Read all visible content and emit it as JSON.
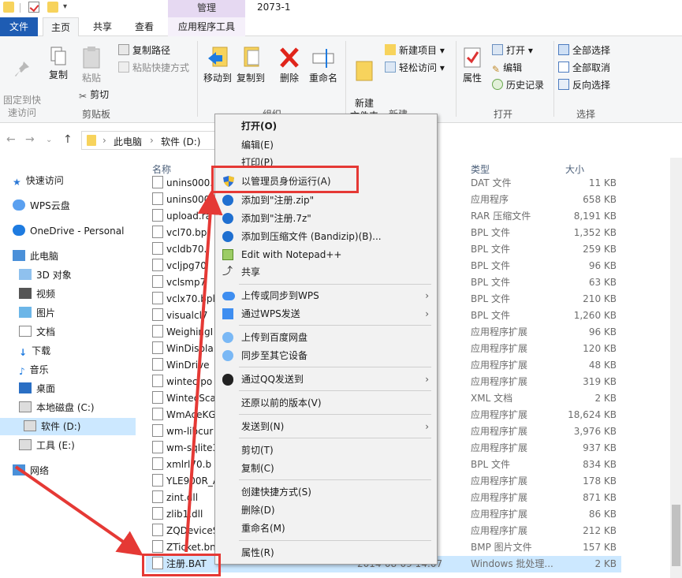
{
  "window": {
    "title": "2073-1",
    "context_tab": "管理"
  },
  "tabs": [
    "文件",
    "主页",
    "共享",
    "查看",
    "应用程序工具"
  ],
  "ribbon": {
    "clipboard": {
      "pin": "固定到快\n速访问",
      "copy": "复制",
      "paste": "粘贴",
      "copy_path": "复制路径",
      "paste_shortcut": "粘贴快捷方式",
      "cut": "剪切",
      "label": "剪贴板"
    },
    "organize": {
      "move_to": "移动到",
      "copy_to": "复制到",
      "delete": "删除",
      "rename": "重命名",
      "label": "组织"
    },
    "new": {
      "new_folder": "新建\n文件夹",
      "new_item": "新建项目",
      "easy_access": "轻松访问",
      "label": "新建"
    },
    "open": {
      "properties": "属性",
      "open": "打开",
      "edit": "编辑",
      "history": "历史记录",
      "label": "打开"
    },
    "select": {
      "select_all": "全部选择",
      "select_none": "全部取消",
      "invert": "反向选择",
      "label": "选择"
    }
  },
  "address": {
    "crumbs": [
      "此电脑",
      "软件 (D:)"
    ]
  },
  "nav": {
    "items": [
      "快速访问",
      "WPS云盘",
      "OneDrive - Personal",
      "此电脑",
      "3D 对象",
      "视频",
      "图片",
      "文档",
      "下载",
      "音乐",
      "桌面",
      "本地磁盘 (C:)",
      "软件 (D:)",
      "工具 (E:)",
      "网络"
    ]
  },
  "filelist": {
    "headers": {
      "name": "名称",
      "type": "类型",
      "size": "大小"
    },
    "rows": [
      {
        "name": "unins000.",
        "type": "DAT 文件",
        "size": "11 KB"
      },
      {
        "name": "unins000.e",
        "type": "应用程序",
        "size": "658 KB"
      },
      {
        "name": "upload.ra",
        "type": "RAR 压缩文件",
        "size": "8,191 KB"
      },
      {
        "name": "vcl70.bpl",
        "type": "BPL 文件",
        "size": "1,352 KB"
      },
      {
        "name": "vcldb70.",
        "type": "BPL 文件",
        "size": "259 KB"
      },
      {
        "name": "vcljpg70",
        "type": "BPL 文件",
        "size": "96 KB"
      },
      {
        "name": "vclsmp7",
        "type": "BPL 文件",
        "size": "63 KB"
      },
      {
        "name": "vclx70.bpl",
        "type": "BPL 文件",
        "size": "210 KB"
      },
      {
        "name": "visualcl7",
        "type": "BPL 文件",
        "size": "1,260 KB"
      },
      {
        "name": "WeighingI",
        "type": "应用程序扩展",
        "size": "96 KB"
      },
      {
        "name": "WinDispla",
        "type": "应用程序扩展",
        "size": "120 KB"
      },
      {
        "name": "WinDrive",
        "type": "应用程序扩展",
        "size": "48 KB"
      },
      {
        "name": "wintec.po",
        "type": "应用程序扩展",
        "size": "319 KB"
      },
      {
        "name": "WintecSca",
        "type": "XML 文档",
        "size": "2 KB"
      },
      {
        "name": "WmAceKG",
        "type": "应用程序扩展",
        "size": "18,624 KB"
      },
      {
        "name": "wm-libcur",
        "type": "应用程序扩展",
        "size": "3,976 KB"
      },
      {
        "name": "wm-sqlite3",
        "type": "应用程序扩展",
        "size": "937 KB"
      },
      {
        "name": "xmlrl70.b",
        "type": "BPL 文件",
        "size": "834 KB"
      },
      {
        "name": "YLE900R_A",
        "type": "应用程序扩展",
        "size": "178 KB"
      },
      {
        "name": "zint.dll",
        "type": "应用程序扩展",
        "size": "871 KB"
      },
      {
        "name": "zlib1.dll",
        "type": "应用程序扩展",
        "size": "86 KB"
      },
      {
        "name": "ZQDeviceS",
        "type": "应用程序扩展",
        "size": "212 KB"
      },
      {
        "name": "ZTicket.bn",
        "type": "BMP 图片文件",
        "size": "157 KB"
      },
      {
        "name": "注册.BAT",
        "type": "Windows 批处理...",
        "size": "2 KB"
      }
    ],
    "partial_date": "2014-08-09 14:07"
  },
  "context_menu": {
    "items": [
      {
        "label": "打开(O)"
      },
      {
        "label": "编辑(E)"
      },
      {
        "label": "打印(P)"
      },
      {
        "label": "以管理员身份运行(A)"
      },
      {
        "label": "添加到\"注册.zip\""
      },
      {
        "label": "添加到\"注册.7z\""
      },
      {
        "label": "添加到压缩文件 (Bandizip)(B)..."
      },
      {
        "label": "Edit with Notepad++"
      },
      {
        "label": "共享"
      },
      {
        "label": "上传或同步到WPS"
      },
      {
        "label": "通过WPS发送"
      },
      {
        "label": "上传到百度网盘"
      },
      {
        "label": "同步至其它设备"
      },
      {
        "label": "通过QQ发送到"
      },
      {
        "label": "还原以前的版本(V)"
      },
      {
        "label": "发送到(N)"
      },
      {
        "label": "剪切(T)"
      },
      {
        "label": "复制(C)"
      },
      {
        "label": "创建快捷方式(S)"
      },
      {
        "label": "删除(D)"
      },
      {
        "label": "重命名(M)"
      },
      {
        "label": "属性(R)"
      }
    ]
  },
  "colors": {
    "highlight": "#e53935",
    "selection": "#cce8ff",
    "file_tab": "#1e5cb3"
  }
}
